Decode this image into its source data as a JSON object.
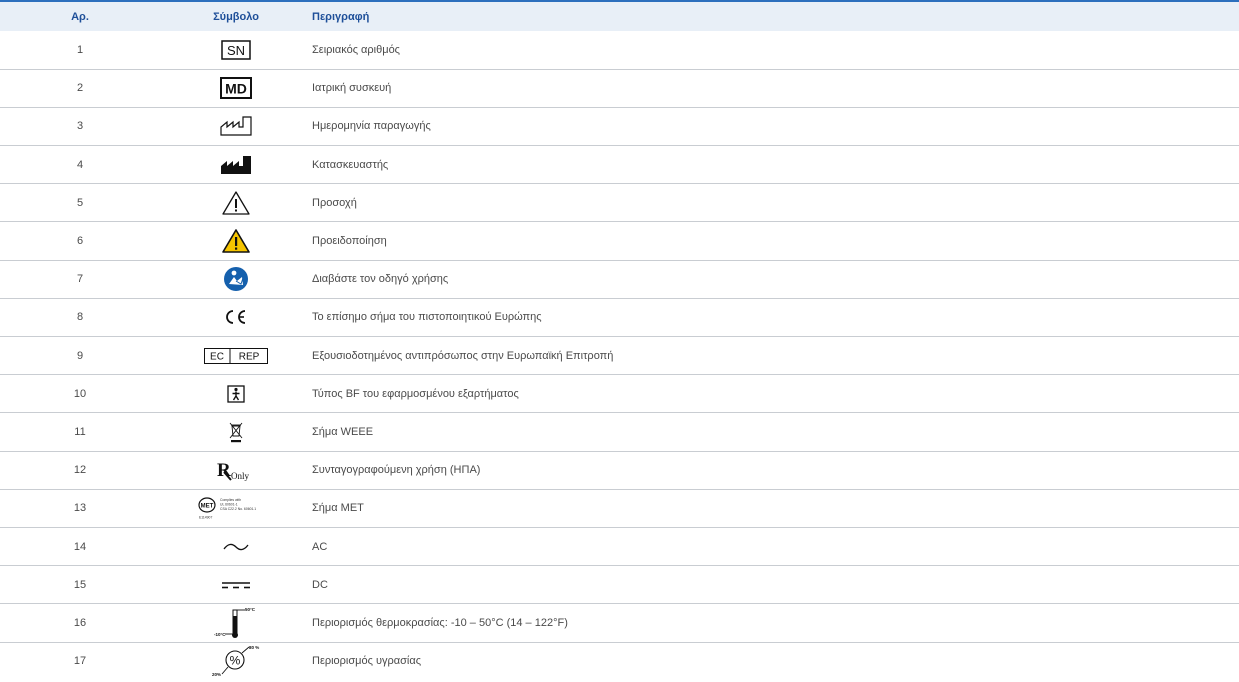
{
  "headers": {
    "no": "Αρ.",
    "symbol": "Σύμβολο",
    "description": "Περιγραφή"
  },
  "rows": [
    {
      "no": "1",
      "icon": "serial-number-sn-icon",
      "desc": "Σειριακός αριθμός",
      "sym_text": "SN"
    },
    {
      "no": "2",
      "icon": "medical-device-md-icon",
      "desc": "Ιατρική συσκευή",
      "sym_text": "MD"
    },
    {
      "no": "3",
      "icon": "date-of-manufacture-icon",
      "desc": "Ημερομηνία παραγωγής"
    },
    {
      "no": "4",
      "icon": "manufacturer-icon",
      "desc": "Κατασκευαστής"
    },
    {
      "no": "5",
      "icon": "caution-icon",
      "desc": "Προσοχή"
    },
    {
      "no": "6",
      "icon": "warning-icon",
      "desc": "Προειδοποίηση"
    },
    {
      "no": "7",
      "icon": "read-manual-icon",
      "desc": "Διαβάστε τον οδηγό χρήσης"
    },
    {
      "no": "8",
      "icon": "ce-mark-icon",
      "desc": "Το επίσημο σήμα του πιστοποιητικού Ευρώπης"
    },
    {
      "no": "9",
      "icon": "ec-rep-icon",
      "desc": "Εξουσιοδοτημένος αντιπρόσωπος στην Ευρωπαϊκή Επιτροπή",
      "sym_left": "EC",
      "sym_right": "REP"
    },
    {
      "no": "10",
      "icon": "type-bf-applied-part-icon",
      "desc": "Τύπος BF του εφαρμοσμένου εξαρτήματος"
    },
    {
      "no": "11",
      "icon": "weee-icon",
      "desc": "Σήμα WEEE"
    },
    {
      "no": "12",
      "icon": "rx-only-icon",
      "desc": "Συνταγογραφούμενη χρήση (ΗΠΑ)",
      "sym_text": "Only"
    },
    {
      "no": "13",
      "icon": "met-mark-icon",
      "desc": "Σήμα MET",
      "sym_text": "MET",
      "met_lines": [
        "Complies with",
        "UL 60601-1",
        "CSA C22.2 No. 60601.1"
      ],
      "met_code": "E114907"
    },
    {
      "no": "14",
      "icon": "alternating-current-icon",
      "desc": "AC"
    },
    {
      "no": "15",
      "icon": "direct-current-icon",
      "desc": "DC"
    },
    {
      "no": "16",
      "icon": "temperature-limit-icon",
      "desc": "Περιορισμός θερμοκρασίας: -10 – 50°C (14 – 122°F)",
      "sym_high": "50°C",
      "sym_low": "-10°C"
    },
    {
      "no": "17",
      "icon": "humidity-limit-icon",
      "desc": "Περιορισμός υγρασίας",
      "sym_high": "80 %",
      "sym_low": "20%",
      "sym_text": "%"
    }
  ],
  "colors": {
    "header_bg": "#e8eff7",
    "header_text": "#1e4f99",
    "header_rule": "#2c6fbd",
    "warning_yellow": "#f5c400",
    "manual_blue": "#1560ad"
  }
}
